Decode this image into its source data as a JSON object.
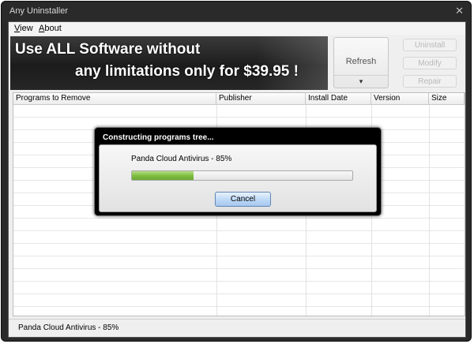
{
  "window": {
    "title": "Any Uninstaller",
    "close_glyph": "✕"
  },
  "menu": {
    "items": [
      {
        "label": "View",
        "accesskey": "V"
      },
      {
        "label": "About",
        "accesskey": "A"
      }
    ]
  },
  "banner": {
    "line1": "Use ALL Software without",
    "line2": "any limitations only for $39.95 !"
  },
  "toolbar": {
    "refresh_label": "Refresh",
    "refresh_dropdown_glyph": "▾",
    "uninstall_label": "Uninstall",
    "modify_label": "Modify",
    "repair_label": "Repair"
  },
  "table": {
    "columns": [
      "Programs to Remove",
      "Publisher",
      "Install Date",
      "Version",
      "Size"
    ],
    "rows": []
  },
  "dialog": {
    "title": "Constructing programs tree...",
    "message": "Panda Cloud Antivirus - 85%",
    "progress": 0.28,
    "cancel_label": "Cancel"
  },
  "statusbar": {
    "text": "Panda Cloud Antivirus - 85%"
  },
  "colors": {
    "progress_fill": "#7fbf42",
    "dialog_frame": "#000000",
    "cancel_button": "#b9d6f5"
  }
}
